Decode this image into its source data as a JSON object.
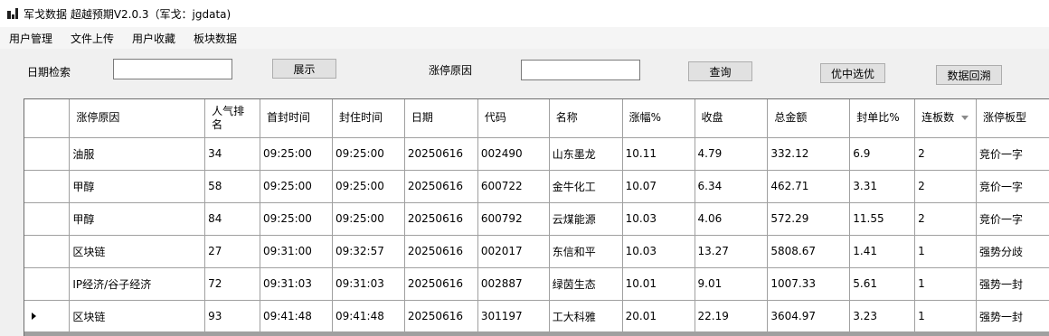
{
  "window": {
    "title": "军戈数据 超越预期V2.0.3（军戈：jgdata)"
  },
  "menu": {
    "items": [
      "用户管理",
      "文件上传",
      "用户收藏",
      "板块数据"
    ]
  },
  "search": {
    "date_label": "日期检索",
    "date_value": "",
    "show_button": "展示",
    "reason_label": "涨停原因",
    "reason_value": "",
    "query_button": "查询",
    "pick_button": "优中选优",
    "backtrack_button": "数据回溯"
  },
  "table": {
    "columns": [
      "涨停原因",
      "人气排名",
      "首封时间",
      "封住时间",
      "日期",
      "代码",
      "名称",
      "涨幅%",
      "收盘",
      "总金额",
      "封单比%",
      "连板数",
      "涨停板型"
    ],
    "sorted_column": "连板数",
    "current_row_index": 5,
    "rows": [
      [
        "油服",
        "34",
        "09:25:00",
        "09:25:00",
        "20250616",
        "002490",
        "山东墨龙",
        "10.11",
        "4.79",
        "332.12",
        "6.9",
        "2",
        "竞价一字"
      ],
      [
        "甲醇",
        "58",
        "09:25:00",
        "09:25:00",
        "20250616",
        "600722",
        "金牛化工",
        "10.07",
        "6.34",
        "462.71",
        "3.31",
        "2",
        "竞价一字"
      ],
      [
        "甲醇",
        "84",
        "09:25:00",
        "09:25:00",
        "20250616",
        "600792",
        "云煤能源",
        "10.03",
        "4.06",
        "572.29",
        "11.55",
        "2",
        "竞价一字"
      ],
      [
        "区块链",
        "27",
        "09:31:00",
        "09:32:57",
        "20250616",
        "002017",
        "东信和平",
        "10.03",
        "13.27",
        "5808.67",
        "1.41",
        "1",
        "强势分歧"
      ],
      [
        "IP经济/谷子经济",
        "72",
        "09:31:03",
        "09:31:03",
        "20250616",
        "002887",
        "绿茵生态",
        "10.01",
        "9.01",
        "1007.33",
        "5.61",
        "1",
        "强势一封"
      ],
      [
        "区块链",
        "93",
        "09:41:48",
        "09:41:48",
        "20250616",
        "301197",
        "工大科雅",
        "20.01",
        "22.19",
        "3604.97",
        "3.23",
        "1",
        "强势一封"
      ]
    ]
  }
}
